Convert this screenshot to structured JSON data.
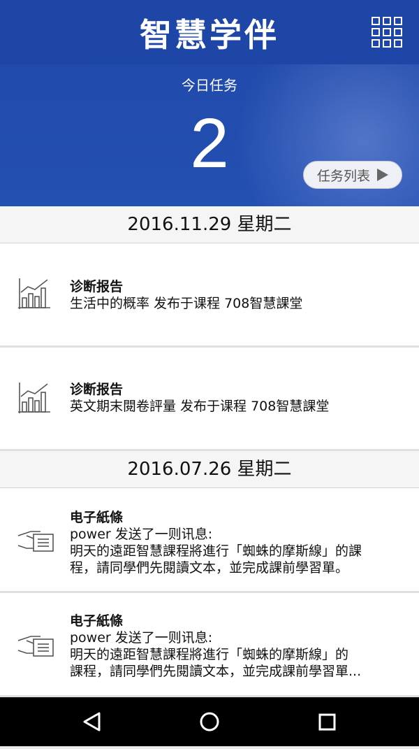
{
  "header": {
    "app_title": "智慧学伴",
    "task_label": "今日任务",
    "task_count": "2",
    "task_list_button": "任务列表"
  },
  "sections": [
    {
      "date": "2016.11.29 星期二",
      "items": [
        {
          "icon": "chart-icon",
          "title": "诊断报告",
          "lines": [
            "生活中的概率 发布于课程 708智慧課堂"
          ]
        },
        {
          "icon": "chart-icon",
          "title": "诊断报告",
          "lines": [
            "英文期末閱卷評量 发布于课程 708智慧課堂"
          ]
        }
      ]
    },
    {
      "date": "2016.07.26 星期二",
      "items": [
        {
          "icon": "hand-note-icon",
          "title": "电子紙條",
          "lines": [
            "power 发送了一则讯息:",
            "明天的遠距智慧課程將進行「蜘蛛的摩斯線」的課",
            "程，請同學們先閱讀文本，並完成課前學習單。"
          ]
        },
        {
          "icon": "hand-note-icon",
          "title": "电子紙條",
          "lines": [
            "power 发送了一则讯息:",
            "明天的遠距智慧課程將進行「蜘蛛的摩斯線」的",
            "課程，請同學們先閱讀文本，並完成課前學習單..."
          ]
        }
      ]
    }
  ],
  "colors": {
    "header_blue": "#2450b3",
    "nav_black": "#000000"
  }
}
